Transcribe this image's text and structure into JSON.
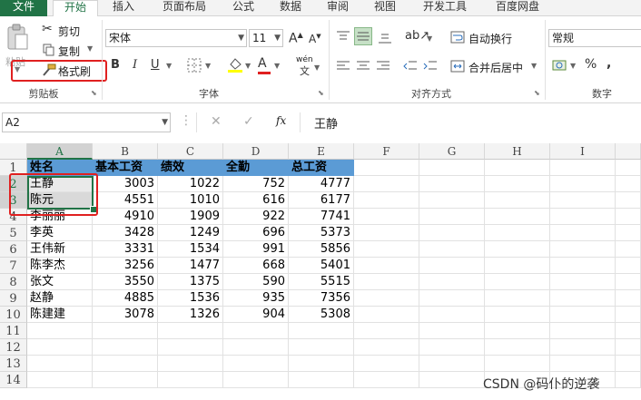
{
  "tabs": [
    "文件",
    "开始",
    "插入",
    "页面布局",
    "公式",
    "数据",
    "审阅",
    "视图",
    "开发工具",
    "百度网盘"
  ],
  "ribbon": {
    "clipboard": {
      "paste": "粘贴",
      "cut": "剪切",
      "copy": "复制",
      "format_painter": "格式刷",
      "group_label": "剪贴板"
    },
    "font": {
      "font_name": "宋体",
      "font_size": "11",
      "bold": "B",
      "italic": "I",
      "underline": "U",
      "phonetic": "wén",
      "group_label": "字体"
    },
    "alignment": {
      "wrap_text": "自动换行",
      "merge_center": "合并后居中",
      "group_label": "对齐方式"
    },
    "number": {
      "format": "常规",
      "percent": "%",
      "comma": ",",
      "group_label": "数字"
    },
    "colors": {
      "accent": "#217346",
      "fill_yellow": "#ffff00",
      "font_red": "#e02020",
      "header_fill": "#5b9bd5",
      "highlight": "#e02020"
    }
  },
  "formula_bar": {
    "name_box": "A2",
    "cancel": "✕",
    "enter": "✓",
    "fx": "fx",
    "content": "王静"
  },
  "sheet": {
    "columns": [
      "A",
      "B",
      "C",
      "D",
      "E",
      "F",
      "G",
      "H",
      "I"
    ],
    "rows": [
      "1",
      "2",
      "3",
      "4",
      "5",
      "6",
      "7",
      "8",
      "9",
      "10",
      "11",
      "12",
      "13",
      "14"
    ],
    "header": [
      "姓名",
      "基本工资",
      "绩效",
      "全勤",
      "总工资"
    ],
    "data": [
      [
        "王静",
        "3003",
        "1022",
        "752",
        "4777"
      ],
      [
        "陈元",
        "4551",
        "1010",
        "616",
        "6177"
      ],
      [
        "李丽丽",
        "4910",
        "1909",
        "922",
        "7741"
      ],
      [
        "李英",
        "3428",
        "1249",
        "696",
        "5373"
      ],
      [
        "王伟新",
        "3331",
        "1534",
        "991",
        "5856"
      ],
      [
        "陈李杰",
        "3256",
        "1477",
        "668",
        "5401"
      ],
      [
        "张文",
        "3550",
        "1375",
        "590",
        "5515"
      ],
      [
        "赵静",
        "4885",
        "1536",
        "935",
        "7356"
      ],
      [
        "陈建建",
        "3078",
        "1326",
        "904",
        "5308"
      ]
    ]
  },
  "watermark": "CSDN @码仆的逆袭"
}
